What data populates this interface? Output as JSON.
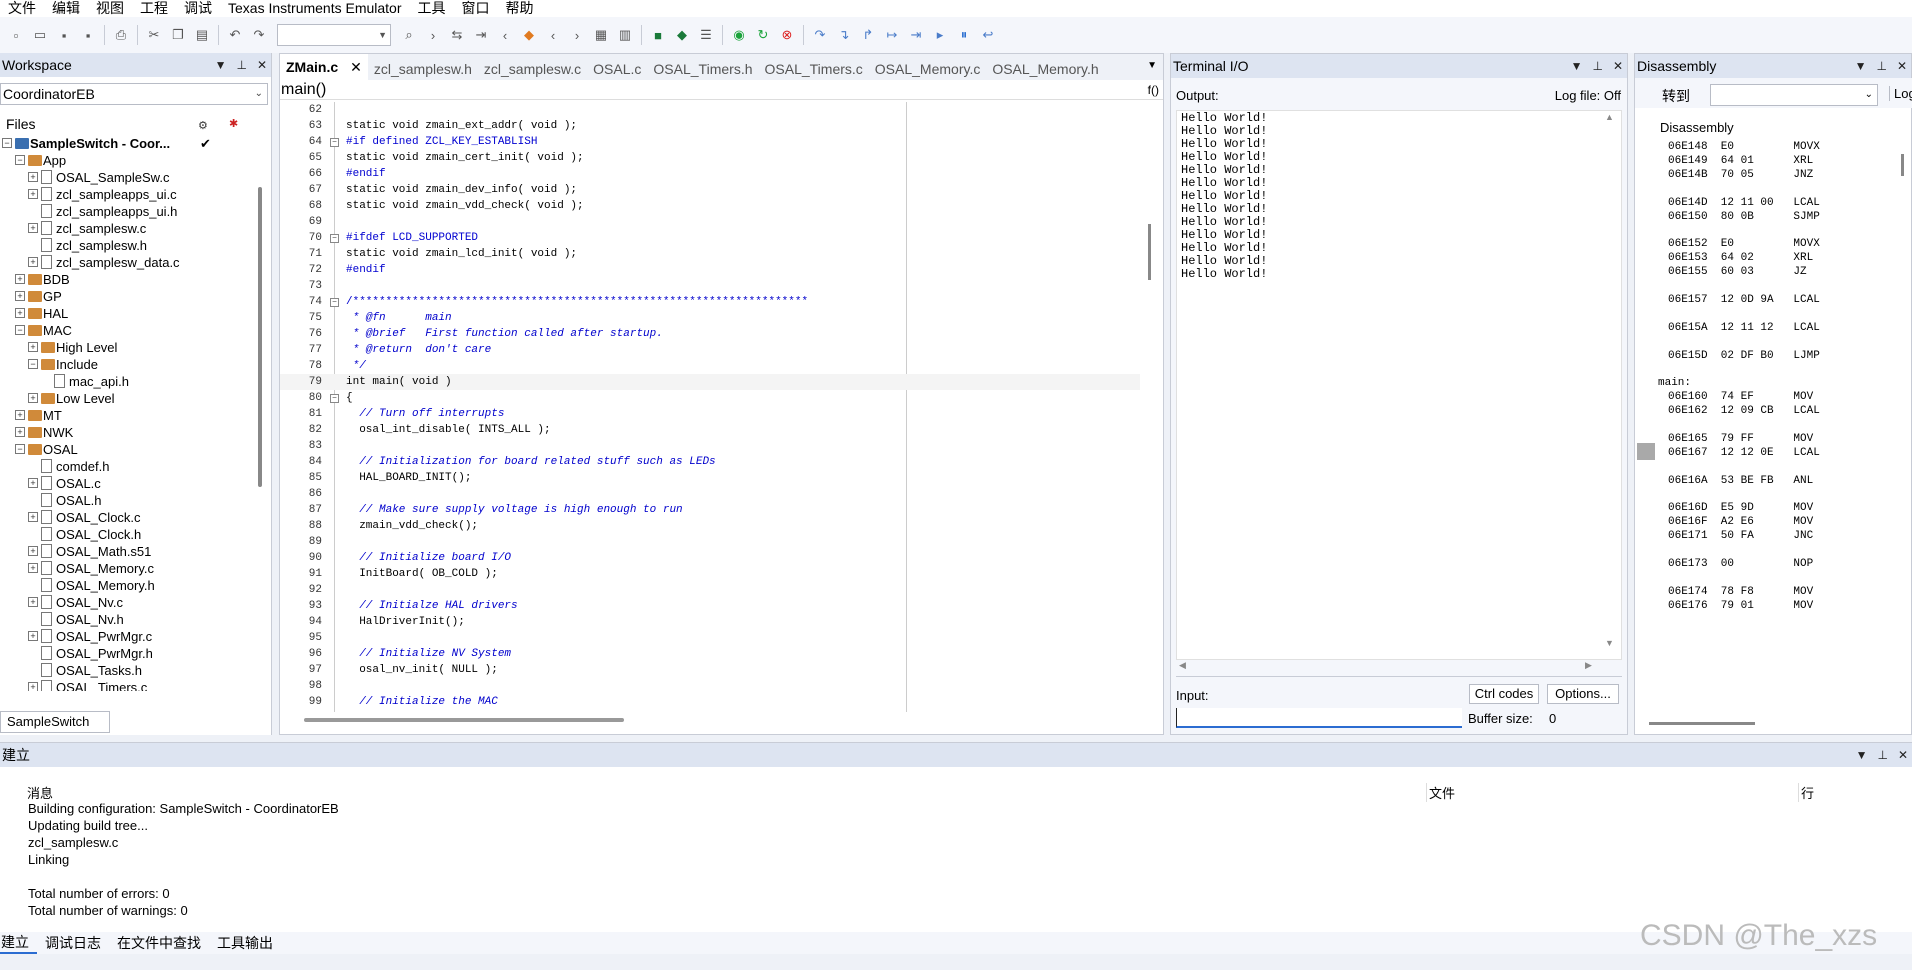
{
  "menubar": {
    "items": [
      "文件",
      "编辑",
      "视图",
      "工程",
      "调试",
      "Texas Instruments Emulator",
      "工具",
      "窗口",
      "帮助"
    ]
  },
  "workspace": {
    "title": "Workspace",
    "configuration": "CoordinatorEB",
    "files_header": "Files",
    "tree": [
      {
        "label": "SampleSwitch - Coor...",
        "type": "project",
        "depth": 0,
        "box": "−",
        "bold": true
      },
      {
        "label": "App",
        "type": "folder",
        "depth": 1,
        "box": "−"
      },
      {
        "label": "OSAL_SampleSw.c",
        "type": "file",
        "depth": 2,
        "box": "+"
      },
      {
        "label": "zcl_sampleapps_ui.c",
        "type": "file",
        "depth": 2,
        "box": "+"
      },
      {
        "label": "zcl_sampleapps_ui.h",
        "type": "file",
        "depth": 2,
        "box": ""
      },
      {
        "label": "zcl_samplesw.c",
        "type": "file",
        "depth": 2,
        "box": "+"
      },
      {
        "label": "zcl_samplesw.h",
        "type": "file",
        "depth": 2,
        "box": ""
      },
      {
        "label": "zcl_samplesw_data.c",
        "type": "file",
        "depth": 2,
        "box": "+"
      },
      {
        "label": "BDB",
        "type": "folder",
        "depth": 1,
        "box": "+"
      },
      {
        "label": "GP",
        "type": "folder",
        "depth": 1,
        "box": "+"
      },
      {
        "label": "HAL",
        "type": "folder",
        "depth": 1,
        "box": "+"
      },
      {
        "label": "MAC",
        "type": "folder",
        "depth": 1,
        "box": "−"
      },
      {
        "label": "High Level",
        "type": "folder",
        "depth": 2,
        "box": "+"
      },
      {
        "label": "Include",
        "type": "folder",
        "depth": 2,
        "box": "−"
      },
      {
        "label": "mac_api.h",
        "type": "file",
        "depth": 3,
        "box": ""
      },
      {
        "label": "Low Level",
        "type": "folder",
        "depth": 2,
        "box": "+"
      },
      {
        "label": "MT",
        "type": "folder",
        "depth": 1,
        "box": "+"
      },
      {
        "label": "NWK",
        "type": "folder",
        "depth": 1,
        "box": "+"
      },
      {
        "label": "OSAL",
        "type": "folder",
        "depth": 1,
        "box": "−"
      },
      {
        "label": "comdef.h",
        "type": "file",
        "depth": 2,
        "box": ""
      },
      {
        "label": "OSAL.c",
        "type": "file",
        "depth": 2,
        "box": "+"
      },
      {
        "label": "OSAL.h",
        "type": "file",
        "depth": 2,
        "box": ""
      },
      {
        "label": "OSAL_Clock.c",
        "type": "file",
        "depth": 2,
        "box": "+"
      },
      {
        "label": "OSAL_Clock.h",
        "type": "file",
        "depth": 2,
        "box": ""
      },
      {
        "label": "OSAL_Math.s51",
        "type": "file",
        "depth": 2,
        "box": "+"
      },
      {
        "label": "OSAL_Memory.c",
        "type": "file",
        "depth": 2,
        "box": "+"
      },
      {
        "label": "OSAL_Memory.h",
        "type": "file",
        "depth": 2,
        "box": ""
      },
      {
        "label": "OSAL_Nv.c",
        "type": "file",
        "depth": 2,
        "box": "+"
      },
      {
        "label": "OSAL_Nv.h",
        "type": "file",
        "depth": 2,
        "box": ""
      },
      {
        "label": "OSAL_PwrMgr.c",
        "type": "file",
        "depth": 2,
        "box": "+"
      },
      {
        "label": "OSAL_PwrMgr.h",
        "type": "file",
        "depth": 2,
        "box": ""
      },
      {
        "label": "OSAL_Tasks.h",
        "type": "file",
        "depth": 2,
        "box": ""
      },
      {
        "label": "OSAL_Timers.c",
        "type": "file",
        "depth": 2,
        "box": "+"
      }
    ],
    "bottom_tab": "SampleSwitch"
  },
  "editor": {
    "tabs": [
      "ZMain.c",
      "zcl_samplesw.h",
      "zcl_samplesw.c",
      "OSAL.c",
      "OSAL_Timers.h",
      "OSAL_Timers.c",
      "OSAL_Memory.c",
      "OSAL_Memory.h"
    ],
    "active_tab_close": "✕",
    "function_name": "main()",
    "func_icon": "f()",
    "lines": [
      {
        "n": "62",
        "t": "",
        "c": "kw"
      },
      {
        "n": "63",
        "t": "static void zmain_ext_addr( void );",
        "c": "kw"
      },
      {
        "n": "64",
        "t": "#if defined ZCL_KEY_ESTABLISH",
        "c": "pp",
        "fold": "−"
      },
      {
        "n": "65",
        "t": "static void zmain_cert_init( void );",
        "c": "kw"
      },
      {
        "n": "66",
        "t": "#endif",
        "c": "pp"
      },
      {
        "n": "67",
        "t": "static void zmain_dev_info( void );",
        "c": "kw"
      },
      {
        "n": "68",
        "t": "static void zmain_vdd_check( void );",
        "c": "kw"
      },
      {
        "n": "69",
        "t": "",
        "c": "kw"
      },
      {
        "n": "70",
        "t": "#ifdef LCD_SUPPORTED",
        "c": "pp",
        "fold": "−"
      },
      {
        "n": "71",
        "t": "static void zmain_lcd_init( void );",
        "c": "kw"
      },
      {
        "n": "72",
        "t": "#endif",
        "c": "pp"
      },
      {
        "n": "73",
        "t": "",
        "c": "kw"
      },
      {
        "n": "74",
        "t": "/*********************************************************************",
        "c": "cmgreen",
        "fold": "−"
      },
      {
        "n": "75",
        "t": " * @fn      main",
        "c": "cm"
      },
      {
        "n": "76",
        "t": " * @brief   First function called after startup.",
        "c": "cm"
      },
      {
        "n": "77",
        "t": " * @return  don't care",
        "c": "cm"
      },
      {
        "n": "78",
        "t": " */",
        "c": "cm"
      },
      {
        "n": "79",
        "t": "int main( void )",
        "c": "kw",
        "cur": true
      },
      {
        "n": "80",
        "t": "{",
        "c": "kw",
        "fold": "−"
      },
      {
        "n": "81",
        "t": "  // Turn off interrupts",
        "c": "cm"
      },
      {
        "n": "82",
        "t": "  osal_int_disable( INTS_ALL );",
        "c": "kw"
      },
      {
        "n": "83",
        "t": "",
        "c": "kw"
      },
      {
        "n": "84",
        "t": "  // Initialization for board related stuff such as LEDs",
        "c": "cm"
      },
      {
        "n": "85",
        "t": "  HAL_BOARD_INIT();",
        "c": "kw"
      },
      {
        "n": "86",
        "t": "",
        "c": "kw"
      },
      {
        "n": "87",
        "t": "  // Make sure supply voltage is high enough to run",
        "c": "cm"
      },
      {
        "n": "88",
        "t": "  zmain_vdd_check();",
        "c": "kw"
      },
      {
        "n": "89",
        "t": "",
        "c": "kw"
      },
      {
        "n": "90",
        "t": "  // Initialize board I/O",
        "c": "cm"
      },
      {
        "n": "91",
        "t": "  InitBoard( OB_COLD );",
        "c": "kw"
      },
      {
        "n": "92",
        "t": "",
        "c": "kw"
      },
      {
        "n": "93",
        "t": "  // Initialze HAL drivers",
        "c": "cm"
      },
      {
        "n": "94",
        "t": "  HalDriverInit();",
        "c": "kw"
      },
      {
        "n": "95",
        "t": "",
        "c": "kw"
      },
      {
        "n": "96",
        "t": "  // Initialize NV System",
        "c": "cm"
      },
      {
        "n": "97",
        "t": "  osal_nv_init( NULL );",
        "c": "kw"
      },
      {
        "n": "98",
        "t": "",
        "c": "kw"
      },
      {
        "n": "99",
        "t": "  // Initialize the MAC",
        "c": "cm"
      }
    ]
  },
  "terminal": {
    "title": "Terminal I/O",
    "output_label": "Output:",
    "log_file": "Log file: Off",
    "lines": [
      "Hello World!",
      "Hello World!",
      "Hello World!",
      "Hello World!",
      "Hello World!",
      "Hello World!",
      "Hello World!",
      "Hello World!",
      "Hello World!",
      "Hello World!",
      "Hello World!",
      "Hello World!",
      "Hello World!"
    ],
    "input_label": "Input:",
    "ctrl_codes": "Ctrl codes",
    "options": "Options...",
    "buffer_label": "Buffer size:",
    "buffer_value": "0"
  },
  "disassembly": {
    "title": "Disassembly",
    "goto_label": "转到",
    "log_label": "Log",
    "header": "Disassembly",
    "rows": [
      "06E148  E0         MOVX",
      "06E149  64 01      XRL",
      "06E14B  70 05      JNZ",
      "",
      "06E14D  12 11 00   LCAL",
      "06E150  80 0B      SJMP",
      "",
      "06E152  E0         MOVX",
      "06E153  64 02      XRL",
      "06E155  60 03      JZ",
      "",
      "06E157  12 0D 9A   LCAL",
      "",
      "06E15A  12 11 12   LCAL",
      "",
      "06E15D  02 DF B0   LJMP",
      "",
      "main:",
      "06E160  74 EF      MOV",
      "06E162  12 09 CB   LCAL",
      "",
      "06E165  79 FF      MOV",
      "06E167  12 12 0E   LCAL",
      "",
      "06E16A  53 BE FB   ANL",
      "",
      "06E16D  E5 9D      MOV",
      "06E16F  A2 E6      MOV",
      "06E171  50 FA      JNC",
      "",
      "06E173  00         NOP",
      "",
      "06E174  78 F8      MOV",
      "06E176  79 01      MOV"
    ]
  },
  "build": {
    "title": "建立",
    "col_message": "消息",
    "col_file": "文件",
    "col_line": "行",
    "messages": [
      "Building configuration: SampleSwitch - CoordinatorEB",
      "Updating build tree...",
      "zcl_samplesw.c",
      "Linking",
      "",
      "Total number of errors: 0",
      "Total number of warnings: 0"
    ]
  },
  "bottom_tabs": [
    "建立",
    "调试日志",
    "在文件中查找",
    "工具输出"
  ],
  "watermark": "CSDN @The_xzs",
  "colors": {
    "accent": "#dde4f1",
    "comment": "#0000cc",
    "preprocessor": "#0000d0",
    "folder": "#d08a3a"
  }
}
